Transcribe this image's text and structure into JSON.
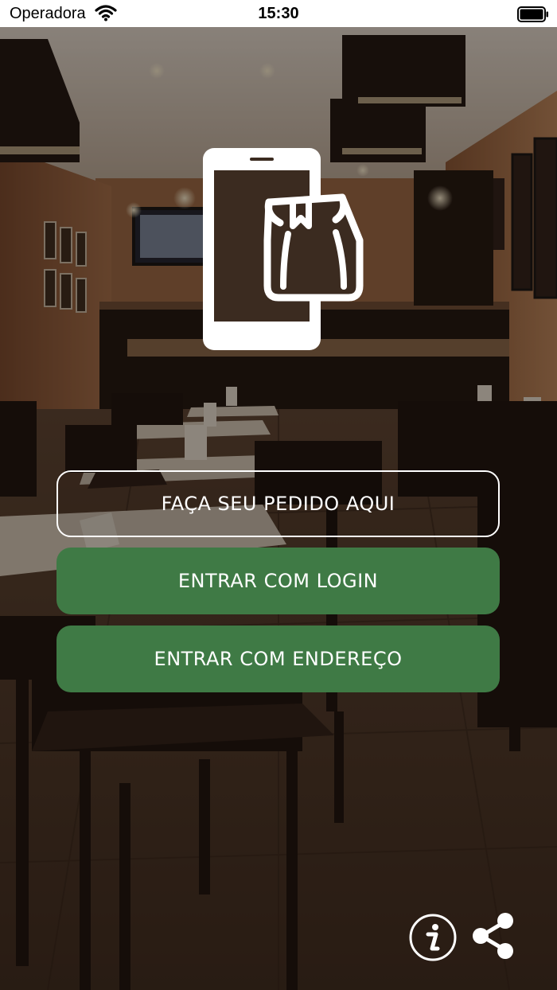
{
  "status_bar": {
    "carrier": "Operadora",
    "time": "15:30",
    "wifi_icon": "wifi-icon",
    "battery_icon": "battery-full-icon"
  },
  "hero": {
    "icon": "phone-with-bag-icon"
  },
  "buttons": {
    "order_label": "FAÇA SEU PEDIDO AQUI",
    "login_label": "ENTRAR COM LOGIN",
    "address_label": "ENTRAR COM ENDEREÇO"
  },
  "footer": {
    "info_icon": "info-icon",
    "share_icon": "share-icon"
  },
  "colors": {
    "primary_green": "#3f7a45",
    "text_white": "#ffffff"
  }
}
